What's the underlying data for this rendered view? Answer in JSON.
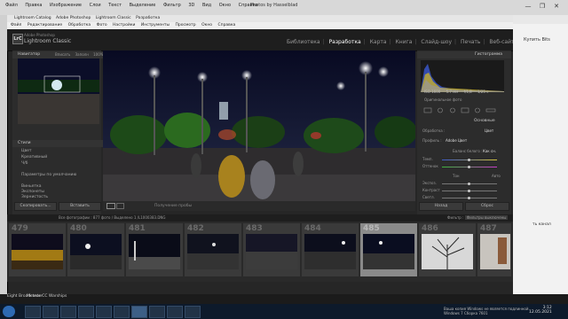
{
  "os_window": {
    "menu": [
      "Файл",
      "Правка",
      "Изображение",
      "Слои",
      "Текст",
      "Выделение",
      "Фильтр",
      "3D",
      "Вид",
      "Окно",
      "Справка"
    ],
    "title": "Photos by Hasselblad",
    "controls": [
      "—",
      "❐",
      "✕"
    ]
  },
  "lightroom": {
    "window_title": [
      "Lightroom Catalog",
      "Adobe Photoshop",
      "Lightroom Classic",
      "Разработка"
    ],
    "menu": [
      "Файл",
      "Редактирование",
      "Обработка",
      "Фото",
      "Настройки",
      "Инструменты",
      "Просмотр",
      "Окно",
      "Справка"
    ],
    "brand_small": "Adobe Photoshop",
    "brand": "Lightroom Classic",
    "logo": "LrC",
    "modules": [
      "Библиотека",
      "Разработка",
      "Карта",
      "Книга",
      "Слайд-шоу",
      "Печать",
      "Веб-сайт"
    ],
    "active_module": "Разработка"
  },
  "left_panel": {
    "navigator": "Навигатор",
    "nav_options": [
      "Вписать",
      "Заполн",
      "100%",
      "300%"
    ],
    "presets_title": "Стили",
    "preset_items": [
      "Цвет",
      "Креативный",
      "Ч/б",
      "Параметры по умолчанию",
      "Виньетка",
      "Экспонеты",
      "Зернистость"
    ],
    "copy_button": "Скопировать...",
    "paste_button": "Вставить"
  },
  "toolbar": {
    "soft_proof": "Получение пробы"
  },
  "right_panel": {
    "histogram_title": "Гистограмма",
    "hist_info": [
      "ISO 1600",
      "5.7 мм",
      "f/1,8",
      "1/25 с"
    ],
    "original_photo": "Оригинальное фото",
    "basic_title": "Основные",
    "treatment_label": "Обработка :",
    "treatment_value": "Цвет",
    "profile_label": "Профиль :",
    "profile_value": "Adobe Цвет",
    "wb_label": "Баланс белого :",
    "wb_value": "Как сн.",
    "temp_label": "Темп.",
    "tint_label": "Оттенок",
    "tone_label": "Тон",
    "auto_label": "Авто",
    "exposure_label": "Экспоз.",
    "contrast_label": "Контраст",
    "highlights_label": "Светл.",
    "prev_button": "Назад",
    "reset_button": "Сброс"
  },
  "filmstrip": {
    "info": "Все фотографии : 877 фото / Выделено 1 /L1000383.DNG",
    "filter_label": "Фильтр :",
    "filter_value": "Фильтры выключены",
    "cells": [
      {
        "num": "479"
      },
      {
        "num": "480"
      },
      {
        "num": "481"
      },
      {
        "num": "482"
      },
      {
        "num": "483"
      },
      {
        "num": "484"
      },
      {
        "num": "485"
      },
      {
        "num": "486"
      },
      {
        "num": "487"
      }
    ],
    "selected_index": 6
  },
  "right_window": {
    "buy_label": "Купить Bits",
    "note": "ть канал"
  },
  "desktop": {
    "icon1": "Eight Broadcaster",
    "icon2": "Meteor CC Warships"
  },
  "taskbar": {
    "tray_text": "Ваша копия Windows не является подлинной",
    "build": "Windows 7 Сборка 7601",
    "time": "3:12",
    "date": "12.05.2021"
  },
  "colors": {
    "accent": "#2e6ab3",
    "panel": "#2c2c2c"
  }
}
